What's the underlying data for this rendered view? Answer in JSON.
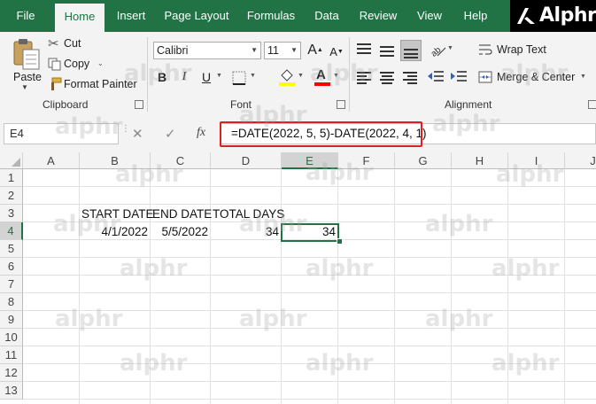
{
  "menu": {
    "tabs": [
      {
        "label": "File"
      },
      {
        "label": "Home"
      },
      {
        "label": "Insert"
      },
      {
        "label": "Page Layout"
      },
      {
        "label": "Formulas"
      },
      {
        "label": "Data"
      },
      {
        "label": "Review"
      },
      {
        "label": "View"
      },
      {
        "label": "Help"
      }
    ],
    "active_tab": "Home",
    "brand": "Alphr"
  },
  "ribbon": {
    "clipboard": {
      "paste_label": "Paste",
      "cut_label": "Cut",
      "copy_label": "Copy",
      "format_painter_label": "Format Painter",
      "group_label": "Clipboard"
    },
    "font": {
      "font_name": "Calibri",
      "font_size": "11",
      "group_label": "Font"
    },
    "alignment": {
      "wrap_text_label": "Wrap Text",
      "merge_center_label": "Merge & Center",
      "group_label": "Alignment"
    }
  },
  "formula_bar": {
    "name_box": "E4",
    "cancel_glyph": "✕",
    "enter_glyph": "✓",
    "fx_label": "fx",
    "formula": "=DATE(2022, 5, 5)-DATE(2022, 4, 1)"
  },
  "sheet": {
    "columns": [
      "A",
      "B",
      "C",
      "D",
      "E",
      "F",
      "G",
      "H",
      "I",
      "J"
    ],
    "rows": [
      "1",
      "2",
      "3",
      "4",
      "5",
      "6",
      "7",
      "8",
      "9",
      "10",
      "11",
      "12",
      "13"
    ],
    "selected_column": "E",
    "selected_row": "4",
    "cells": {
      "B3": "START DATE",
      "C3": "END DATE",
      "D3": "TOTAL DAYS",
      "B4": "4/1/2022",
      "C4": "5/5/2022",
      "D4": "34",
      "E4": "34"
    }
  },
  "watermark": {
    "text": "alphr"
  },
  "colors": {
    "excel_green": "#217346",
    "highlight_red": "#e02020",
    "fill_yellow": "#ffff00",
    "font_red": "#ff0000"
  }
}
